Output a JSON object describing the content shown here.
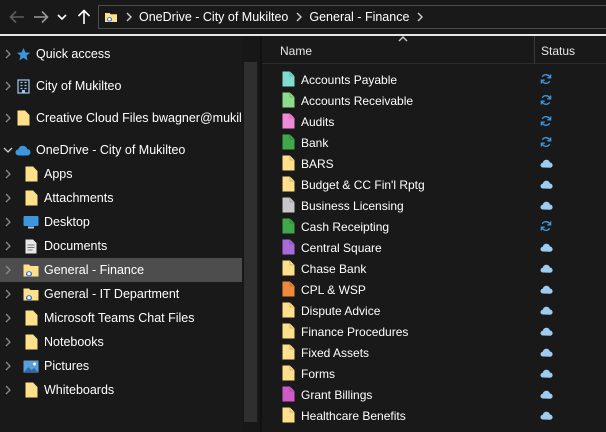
{
  "address": {
    "breadcrumbs": [
      "OneDrive - City of Mukilteo",
      "General - Finance"
    ]
  },
  "nav": {
    "items": [
      {
        "label": "Quick access",
        "icon": "star-icon",
        "level": 0,
        "expanded": false,
        "selected": false
      },
      {
        "label": "City of Mukilteo",
        "icon": "building-icon",
        "level": 0,
        "expanded": false,
        "selected": false
      },
      {
        "label": "Creative Cloud Files  bwagner@mukilte",
        "icon": "folder-icon",
        "level": 0,
        "expanded": false,
        "selected": false
      },
      {
        "label": "OneDrive - City of Mukilteo",
        "icon": "cloud-icon",
        "level": 0,
        "expanded": true,
        "selected": false
      },
      {
        "label": "Apps",
        "icon": "folder-icon",
        "level": 1,
        "expanded": false,
        "selected": false
      },
      {
        "label": "Attachments",
        "icon": "folder-icon",
        "level": 1,
        "expanded": false,
        "selected": false
      },
      {
        "label": "Desktop",
        "icon": "desktop-icon",
        "level": 1,
        "expanded": false,
        "selected": false
      },
      {
        "label": "Documents",
        "icon": "document-icon",
        "level": 1,
        "expanded": false,
        "selected": false
      },
      {
        "label": "General - Finance",
        "icon": "shared-folder-icon",
        "level": 1,
        "expanded": false,
        "selected": true
      },
      {
        "label": "General - IT Department",
        "icon": "shared-folder-icon",
        "level": 1,
        "expanded": false,
        "selected": false
      },
      {
        "label": "Microsoft Teams Chat Files",
        "icon": "folder-icon",
        "level": 1,
        "expanded": false,
        "selected": false
      },
      {
        "label": "Notebooks",
        "icon": "folder-icon",
        "level": 1,
        "expanded": false,
        "selected": false
      },
      {
        "label": "Pictures",
        "icon": "pictures-icon",
        "level": 1,
        "expanded": false,
        "selected": false
      },
      {
        "label": "Whiteboards",
        "icon": "folder-icon",
        "level": 1,
        "expanded": false,
        "selected": false
      }
    ]
  },
  "columns": {
    "name": "Name",
    "status": "Status"
  },
  "files": [
    {
      "name": "Accounts Payable",
      "color": "#7fdcd0",
      "status": "sync-icon"
    },
    {
      "name": "Accounts Receivable",
      "color": "#8edc8a",
      "status": "sync-icon"
    },
    {
      "name": "Audits",
      "color": "#f08ad8",
      "status": "sync-icon"
    },
    {
      "name": "Bank",
      "color": "#3fa84a",
      "status": "sync-icon"
    },
    {
      "name": "BARS",
      "color": "#ffe08a",
      "status": "cloud-icon"
    },
    {
      "name": "Budget & CC Fin'l Rptg",
      "color": "#ffe08a",
      "status": "cloud-icon"
    },
    {
      "name": "Business Licensing",
      "color": "#c8c8c8",
      "status": "cloud-icon"
    },
    {
      "name": "Cash Receipting",
      "color": "#3fa84a",
      "status": "sync-icon"
    },
    {
      "name": "Central Square",
      "color": "#a86ad8",
      "status": "cloud-icon"
    },
    {
      "name": "Chase Bank",
      "color": "#ffe08a",
      "status": "cloud-icon"
    },
    {
      "name": "CPL & WSP",
      "color": "#f08a3a",
      "status": "cloud-icon"
    },
    {
      "name": "Dispute Advice",
      "color": "#ffe08a",
      "status": "cloud-icon"
    },
    {
      "name": "Finance Procedures",
      "color": "#ffe08a",
      "status": "cloud-icon"
    },
    {
      "name": "Fixed Assets",
      "color": "#ffe08a",
      "status": "cloud-icon"
    },
    {
      "name": "Forms",
      "color": "#ffe08a",
      "status": "cloud-icon"
    },
    {
      "name": "Grant Billings",
      "color": "#d05ac8",
      "status": "cloud-icon"
    },
    {
      "name": "Healthcare Benefits",
      "color": "#ffe08a",
      "status": "cloud-icon"
    }
  ],
  "colors": {
    "accent": "#3a96dd",
    "folder": "#ffe08a",
    "selected": "#4d4d4d"
  }
}
